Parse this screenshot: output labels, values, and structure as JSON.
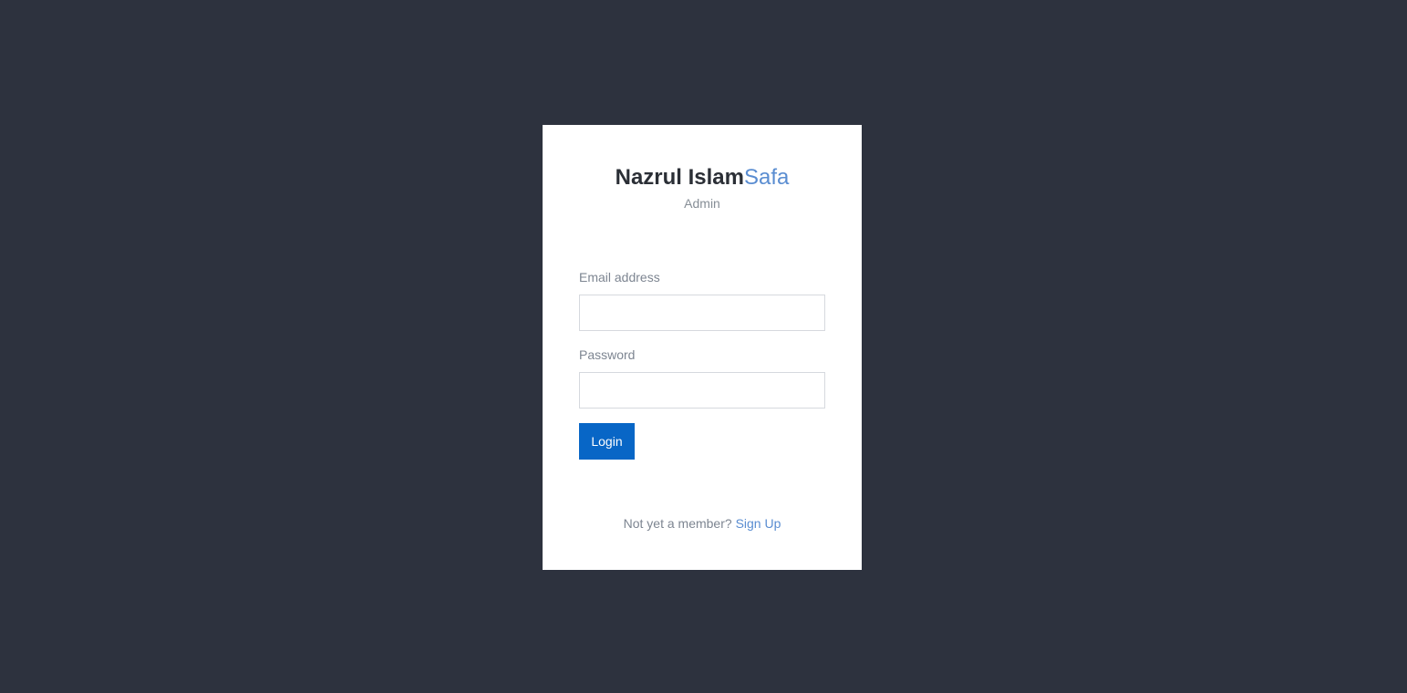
{
  "brand": {
    "name_bold": "Nazrul Islam",
    "name_accent": "Safa",
    "subtitle": "Admin"
  },
  "form": {
    "email_label": "Email address",
    "email_value": "",
    "password_label": "Password",
    "password_value": "",
    "login_label": "Login"
  },
  "footer": {
    "prompt": "Not yet a member?",
    "signup_label": "Sign Up"
  },
  "colors": {
    "background": "#2d323e",
    "card": "#ffffff",
    "accent": "#5a8dd1",
    "button": "#0866c6"
  }
}
